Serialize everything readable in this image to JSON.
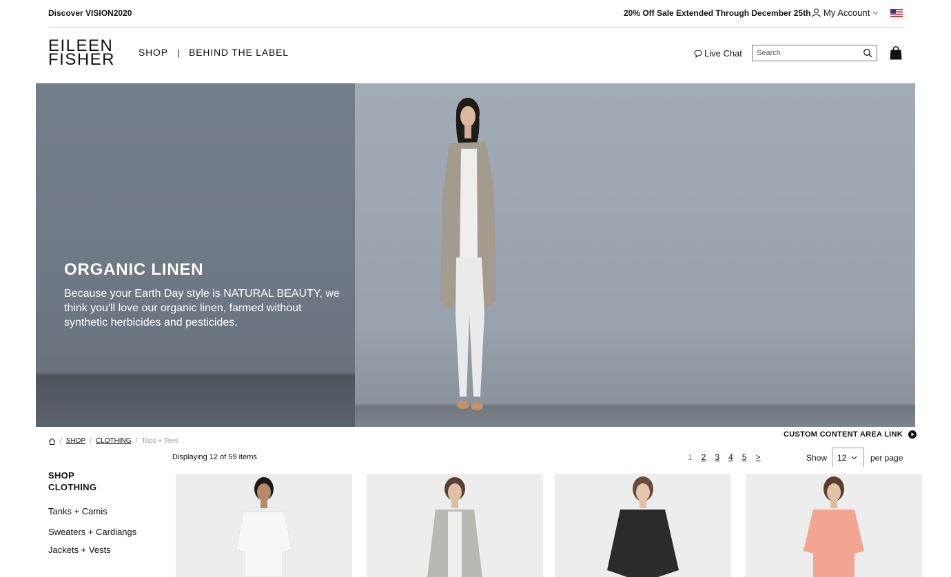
{
  "utility": {
    "discover": "Discover VISION2020",
    "promo": "20% Off Sale Extended Through December 25th",
    "account": "My Account"
  },
  "logo": {
    "line1": "EILEEN",
    "line2": "FISHER"
  },
  "nav": {
    "shop": "SHOP",
    "separator": "|",
    "behind": "BEHIND THE LABEL"
  },
  "header": {
    "live_chat": "Live Chat",
    "search_placeholder": "Search"
  },
  "hero": {
    "title": "ORGANIC LINEN",
    "body": "Because your Earth Day style is NATURAL BEAUTY, we think you'll love our organic linen, farmed without synthetic herbicides and pesticides."
  },
  "breadcrumb": {
    "shop": "SHOP",
    "clothing": "CLOTHING",
    "current": "Tops + Tees"
  },
  "custom_link": "CUSTOM CONTENT AREA LINK",
  "listing": {
    "displaying": "Displaying 12 of 59 items",
    "pages": [
      "1",
      "2",
      "3",
      "4",
      "5",
      ">"
    ],
    "show": "Show",
    "per_page_value": "12",
    "per_page": "per page"
  },
  "sidebar": {
    "title_line1": "SHOP",
    "title_line2": "CLOTHING",
    "items": [
      "Tanks + Camis",
      "Sweaters + Cardiangs",
      "Jackets + Vests"
    ]
  },
  "colors": {
    "text": "#111111",
    "hero_left": "#6e7a86",
    "hero_right": "#a2acb6",
    "product_bg": "#ededed",
    "product_1": "#f4f4f2",
    "product_2": "#b7b7b3",
    "product_3": "#2a2a2a",
    "product_4": "#f0a38f"
  }
}
